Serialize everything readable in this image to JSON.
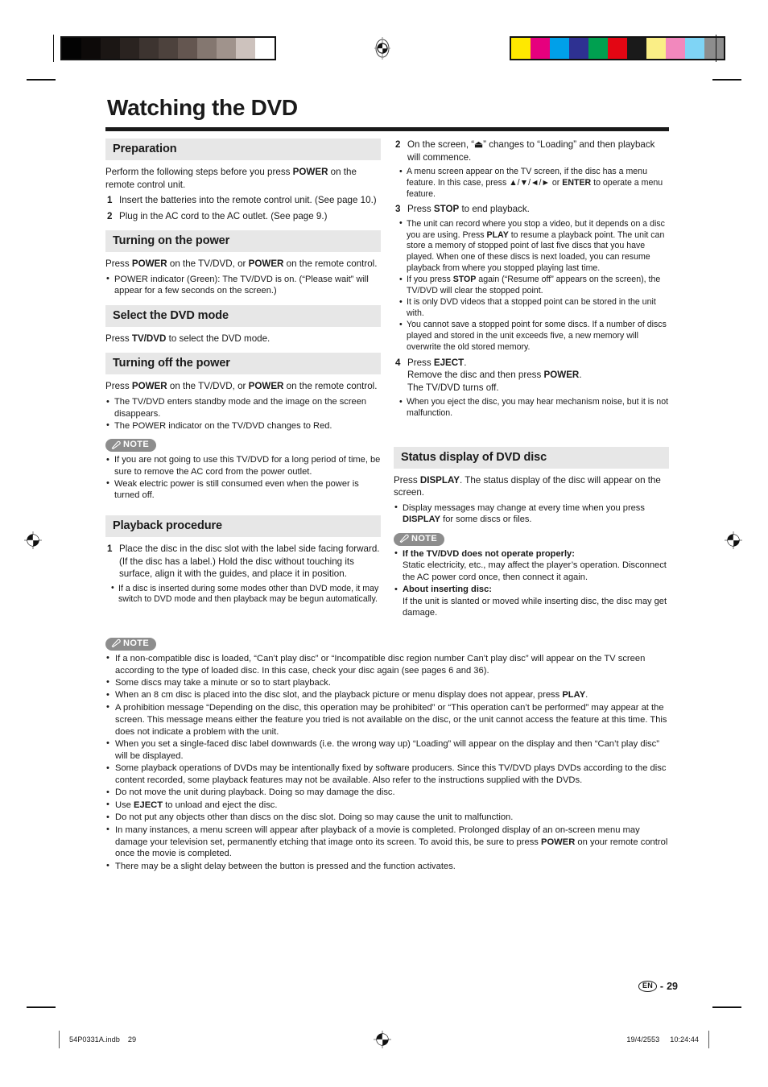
{
  "document": {
    "title": "Watching the DVD",
    "page_number": "29",
    "page_locale": "EN",
    "page_sep": "-"
  },
  "printmarks": {
    "grayscale": [
      "#030303",
      "#0d0a09",
      "#1b1614",
      "#2a2320",
      "#3d3430",
      "#4d423d",
      "#645650",
      "#847770",
      "#a0938c",
      "#cdc2bd",
      "#ffffff"
    ],
    "colorbars": [
      "#ffe800",
      "#e6007e",
      "#00a0e9",
      "#2e3192",
      "#00a050",
      "#e30613",
      "#1a1a1a",
      "#faee86",
      "#f288bd",
      "#7fd4f5",
      "#8d8d8d"
    ]
  },
  "left_column": {
    "preparation": {
      "heading": "Preparation",
      "intro_1": "Perform the following steps before you press ",
      "intro_bold": "POWER",
      "intro_2": " on the remote control unit.",
      "steps": [
        {
          "num": "1",
          "text": "Insert the batteries into the remote control unit. (See page 10.)"
        },
        {
          "num": "2",
          "text": "Plug in the AC cord to the AC outlet. (See page 9.)"
        }
      ]
    },
    "turning_on": {
      "heading": "Turning on the power",
      "body_a": "Press ",
      "body_b": "POWER",
      "body_c": " on the TV/DVD, or ",
      "body_d": "POWER",
      "body_e": " on the remote control.",
      "bullets": [
        "POWER indicator (Green): The TV/DVD is on. (“Please wait” will appear for a few seconds on the screen.)"
      ]
    },
    "select_mode": {
      "heading": "Select the DVD mode",
      "body_a": "Press ",
      "body_b": "TV/DVD",
      "body_c": " to select the DVD mode."
    },
    "turning_off": {
      "heading": "Turning off the power",
      "body_a": "Press ",
      "body_b": "POWER",
      "body_c": " on the TV/DVD, or ",
      "body_d": "POWER",
      "body_e": " on the remote control.",
      "bullets": [
        "The TV/DVD enters standby mode and the image on the screen disappears.",
        "The POWER indicator on the TV/DVD changes to Red."
      ]
    },
    "note_1": {
      "label": "NOTE",
      "bullets": [
        "If you are not going to use this TV/DVD for a long period of time, be sure to remove the AC cord from the power outlet.",
        "Weak electric power is still consumed even when the power is turned off."
      ]
    },
    "playback": {
      "heading": "Playback procedure",
      "step1_num": "1",
      "step1_text": "Place the disc in the disc slot with the label side facing forward. (If the disc has a label.) Hold the disc without touching its surface, align it with the guides, and place it in position.",
      "step1_bullets": [
        "If a disc is inserted during some modes other than DVD mode, it may switch to DVD mode and then playback may be begun automatically."
      ]
    }
  },
  "right_column": {
    "step2": {
      "num": "2",
      "text_a": "On the screen, “",
      "eject_glyph": "⏏",
      "text_b": "” changes to “Loading” and then playback will commence.",
      "bullet_a": "A menu screen appear on the TV screen, if the disc has a menu feature. In this case, press ",
      "arrows": "▲/▼/◄/►",
      "bullet_b": " or ",
      "bullet_bold": "ENTER",
      "bullet_c": " to operate a menu feature."
    },
    "step3": {
      "num": "3",
      "text_a": "Press ",
      "text_bold": "STOP",
      "text_b": " to end playback.",
      "b1_a": "The unit can record where you stop a video, but it depends on a disc you are using. Press ",
      "b1_bold": "PLAY",
      "b1_b": " to resume a playback point. The unit can store a memory of stopped point of last five discs that you have played. When one of these discs is next loaded, you can resume playback from where you stopped playing last time.",
      "b2_a": "If you press ",
      "b2_bold": "STOP",
      "b2_b": " again (“Resume off” appears on the screen), the TV/DVD will clear the stopped point.",
      "b3": "It is only DVD videos that a stopped point can be stored in the unit with.",
      "b4": "You cannot save a stopped point for some discs. If a number of discs played and stored in the unit exceeds five, a new memory will overwrite the old stored memory."
    },
    "step4": {
      "num": "4",
      "line1_a": "Press ",
      "line1_bold": "EJECT",
      "line1_b": ".",
      "line2_a": "Remove the disc and then press ",
      "line2_bold": "POWER",
      "line2_b": ".",
      "line3": "The TV/DVD turns off.",
      "bullets": [
        "When you eject the disc, you may hear mechanism noise, but it is not malfunction."
      ]
    },
    "status_display": {
      "heading": "Status display of DVD disc",
      "body_a": "Press ",
      "body_bold": "DISPLAY",
      "body_b": ". The status display of the disc will appear on the screen.",
      "bullet_a": "Display messages may change at every time when you press ",
      "bullet_bold": "DISPLAY",
      "bullet_b": " for some discs or files."
    },
    "note_2": {
      "label": "NOTE",
      "items": [
        {
          "title": "If the TV/DVD does not operate properly:",
          "text": "Static electricity, etc., may affect the player’s operation. Disconnect the AC power cord once, then connect it again."
        },
        {
          "title": "About inserting disc:",
          "text": "If the unit is slanted or moved while inserting disc, the disc may get damage."
        }
      ]
    }
  },
  "bottom_note": {
    "label": "NOTE",
    "bullets": [
      {
        "a": "If a non-compatible disc is loaded, “Can’t play disc” or “Incompatible disc region number Can’t play disc” will appear on the TV screen according to the type of loaded disc. In this case, check your disc again (see pages 6 and 36).",
        "bold": "",
        "b": ""
      },
      {
        "a": "Some discs may take a minute or so to start playback.",
        "bold": "",
        "b": ""
      },
      {
        "a": "When an 8 cm disc is placed into the disc slot, and the playback picture or menu display does not appear, press ",
        "bold": "PLAY",
        "b": "."
      },
      {
        "a": "A prohibition message “Depending on the disc, this operation may be prohibited” or “This operation can’t be performed” may appear at the screen. This message means either the feature you tried is not available on the disc, or the unit cannot access the feature at this time. This does not indicate a problem with the unit.",
        "bold": "",
        "b": ""
      },
      {
        "a": "When you set a single-faced disc label downwards (i.e. the wrong way up) “Loading” will appear on the display and then “Can’t play disc” will be displayed.",
        "bold": "",
        "b": ""
      },
      {
        "a": "Some playback operations of DVDs may be intentionally fixed by software producers. Since this TV/DVD plays DVDs according to the disc content recorded, some playback features may not be available. Also refer to the instructions supplied with the DVDs.",
        "bold": "",
        "b": ""
      },
      {
        "a": "Do not move the unit during playback. Doing so may damage the disc.",
        "bold": "",
        "b": ""
      },
      {
        "a": "Use ",
        "bold": "EJECT",
        "b": " to unload and eject the disc."
      },
      {
        "a": "Do not put any objects other than discs on the disc slot. Doing so may cause the unit to malfunction.",
        "bold": "",
        "b": ""
      },
      {
        "a": "In many instances, a menu screen will appear after playback of a movie is completed. Prolonged display of an on-screen menu may damage your television set, permanently etching that image onto its screen. To avoid this, be sure to press ",
        "bold": "POWER",
        "b": " on your remote control once the movie is completed."
      },
      {
        "a": "There may be a slight delay between the button is pressed and the function activates.",
        "bold": "",
        "b": ""
      }
    ]
  },
  "footer": {
    "filename": "54P0331A.indb",
    "file_page": "29",
    "date": "19/4/2553",
    "time": "10:24:44"
  }
}
